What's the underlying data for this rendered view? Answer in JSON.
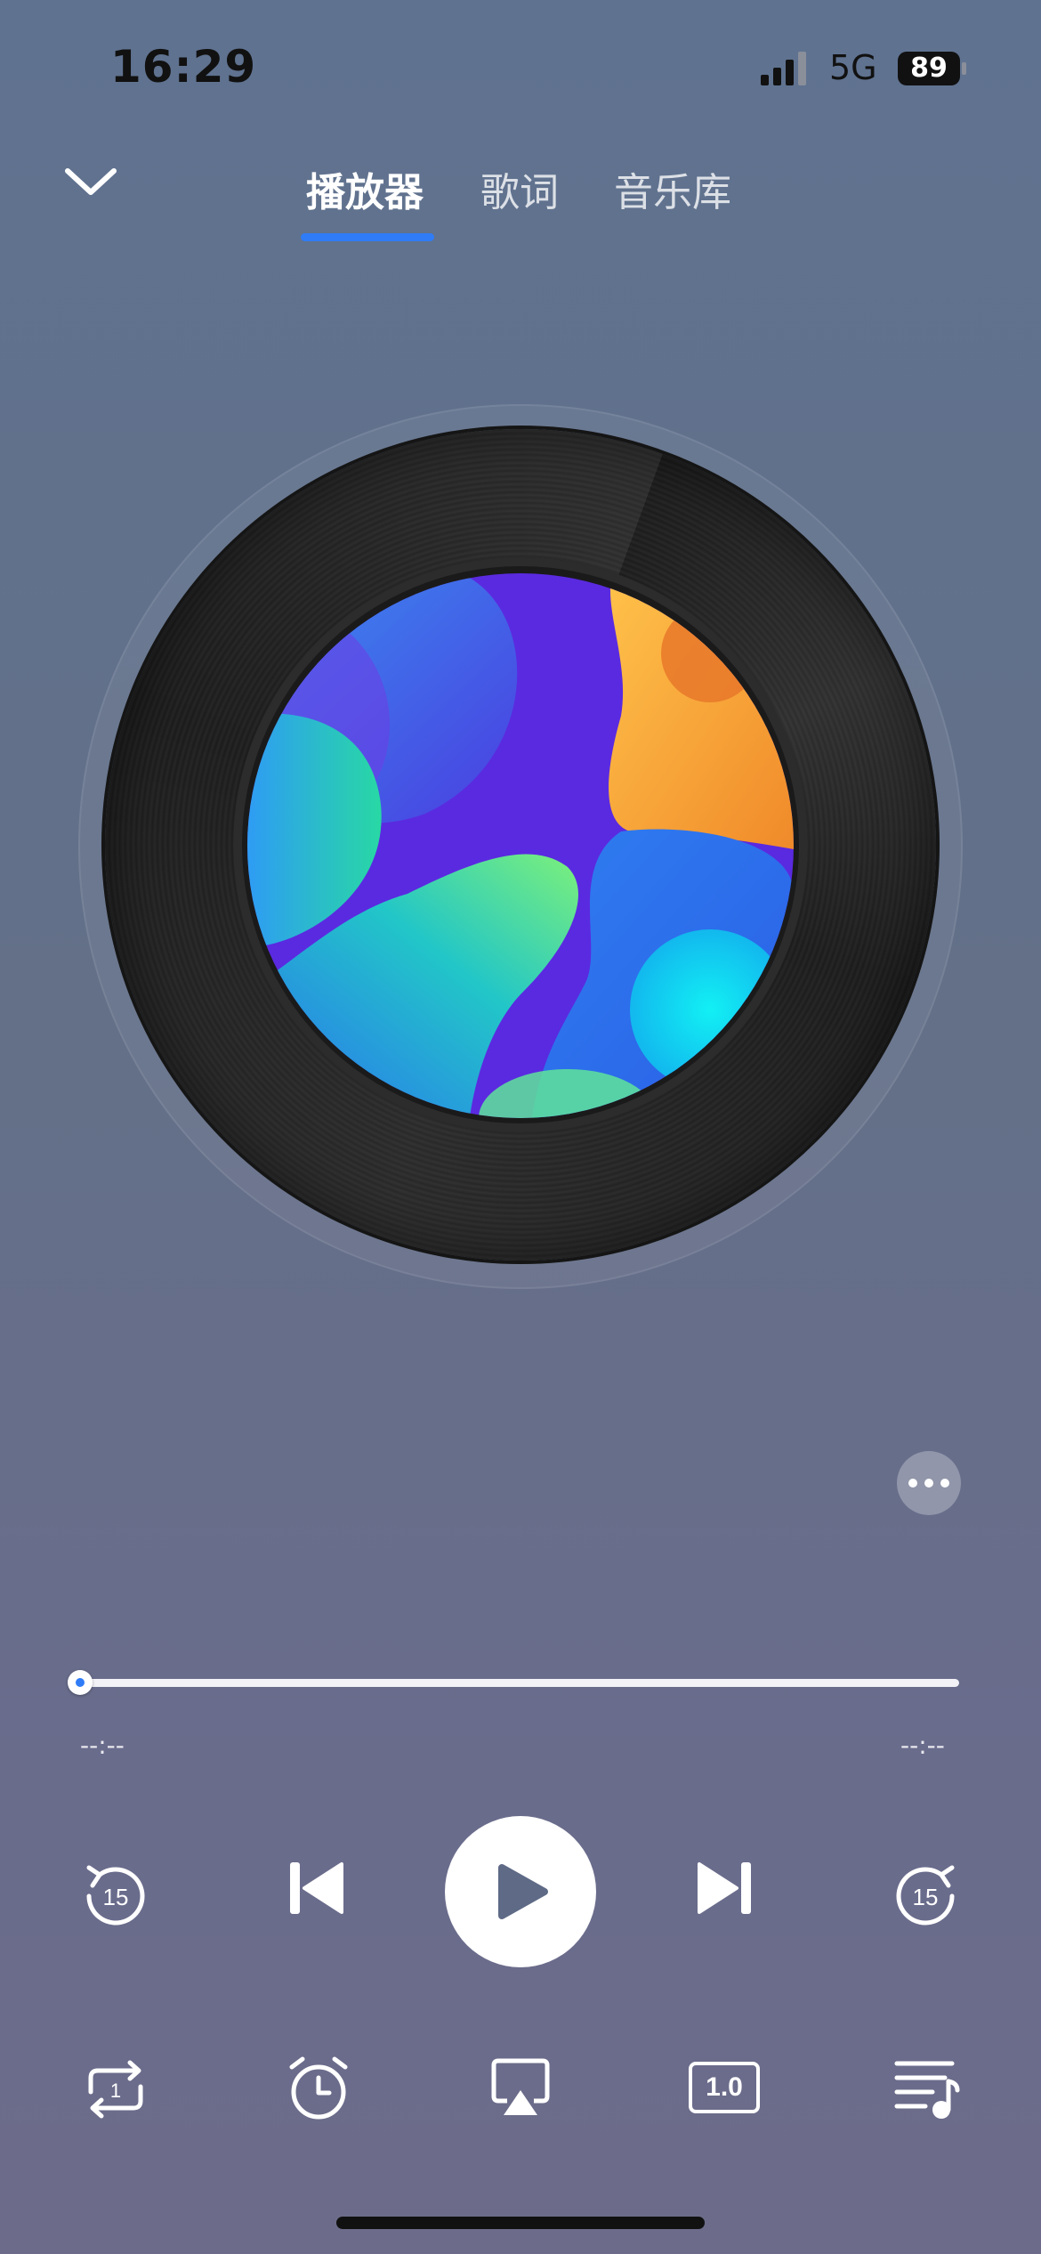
{
  "status_bar": {
    "time": "16:29",
    "network": "5G",
    "battery": "89"
  },
  "tabs": [
    {
      "label": "播放器",
      "active": true
    },
    {
      "label": "歌词",
      "active": false
    },
    {
      "label": "音乐库",
      "active": false
    }
  ],
  "progress": {
    "elapsed": "--:--",
    "remaining": "--:--",
    "fraction": 0
  },
  "controls": {
    "rewind_seconds": "15",
    "forward_seconds": "15",
    "repeat_count": "1",
    "speed": "1.0"
  },
  "colors": {
    "accent": "#2f7cf6"
  },
  "icons": [
    "chevron-down-icon",
    "more-icon",
    "rewind-15-icon",
    "previous-icon",
    "play-icon",
    "next-icon",
    "forward-15-icon",
    "repeat-one-icon",
    "timer-icon",
    "airplay-icon",
    "speed-icon",
    "playlist-icon"
  ]
}
